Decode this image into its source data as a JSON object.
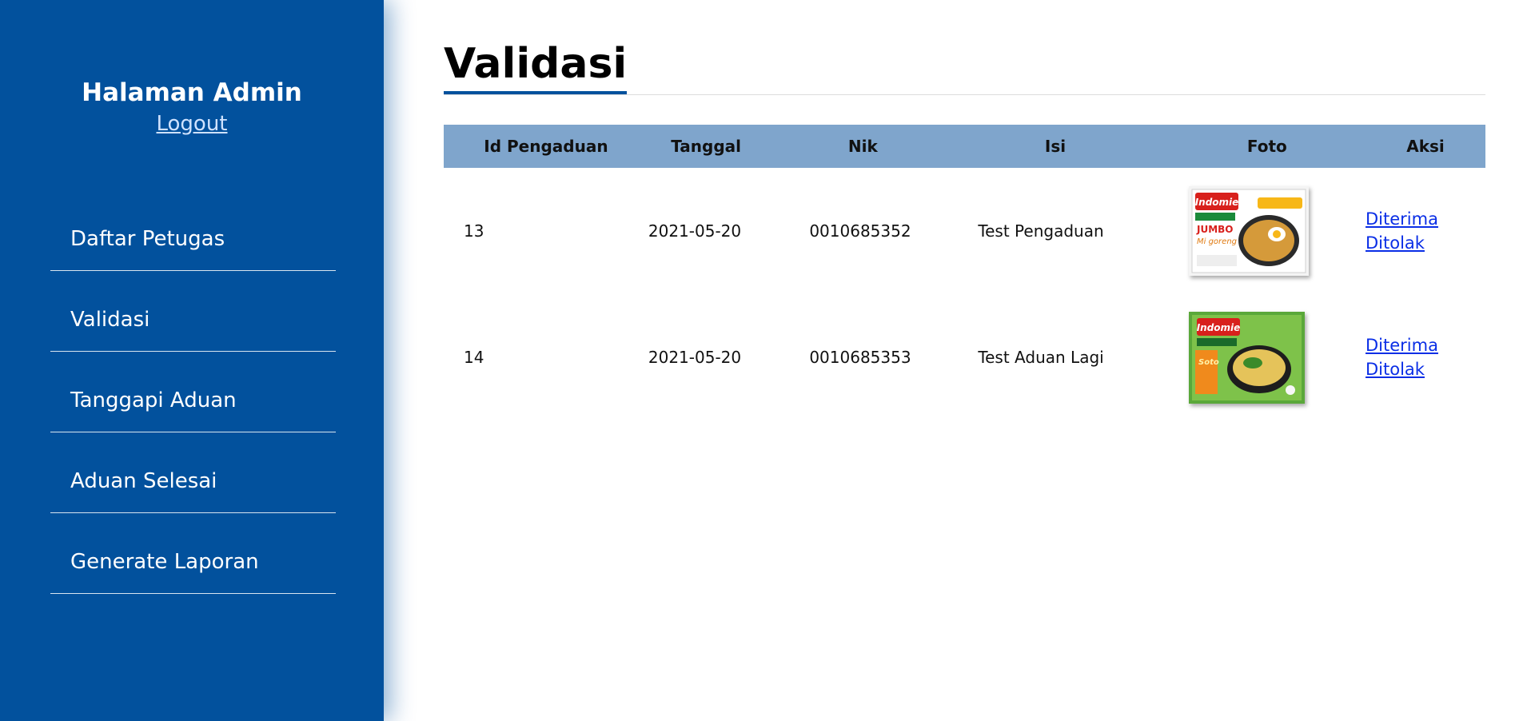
{
  "sidebar": {
    "title": "Halaman Admin",
    "logout_label": "Logout",
    "items": [
      {
        "label": "Daftar Petugas"
      },
      {
        "label": "Validasi"
      },
      {
        "label": "Tanggapi Aduan"
      },
      {
        "label": "Aduan Selesai"
      },
      {
        "label": "Generate Laporan"
      }
    ],
    "bg_color": "#02519d"
  },
  "main": {
    "title": "Validasi",
    "table": {
      "headers": [
        "Id Pengaduan",
        "Tanggal",
        "Nik",
        "Isi",
        "Foto",
        "Aksi"
      ],
      "rows": [
        {
          "id": "13",
          "tanggal": "2021-05-20",
          "nik": "0010685352",
          "isi": "Test Pengaduan",
          "foto": "indomie-jumbo-mi-goreng-package",
          "accept_label": "Diterima",
          "reject_label": "Ditolak"
        },
        {
          "id": "14",
          "tanggal": "2021-05-20",
          "nik": "0010685353",
          "isi": "Test Aduan Lagi",
          "foto": "indomie-soto-package",
          "accept_label": "Diterima",
          "reject_label": "Ditolak"
        }
      ],
      "header_color": "#7fa5cc",
      "link_color": "#0a2ee6"
    }
  }
}
